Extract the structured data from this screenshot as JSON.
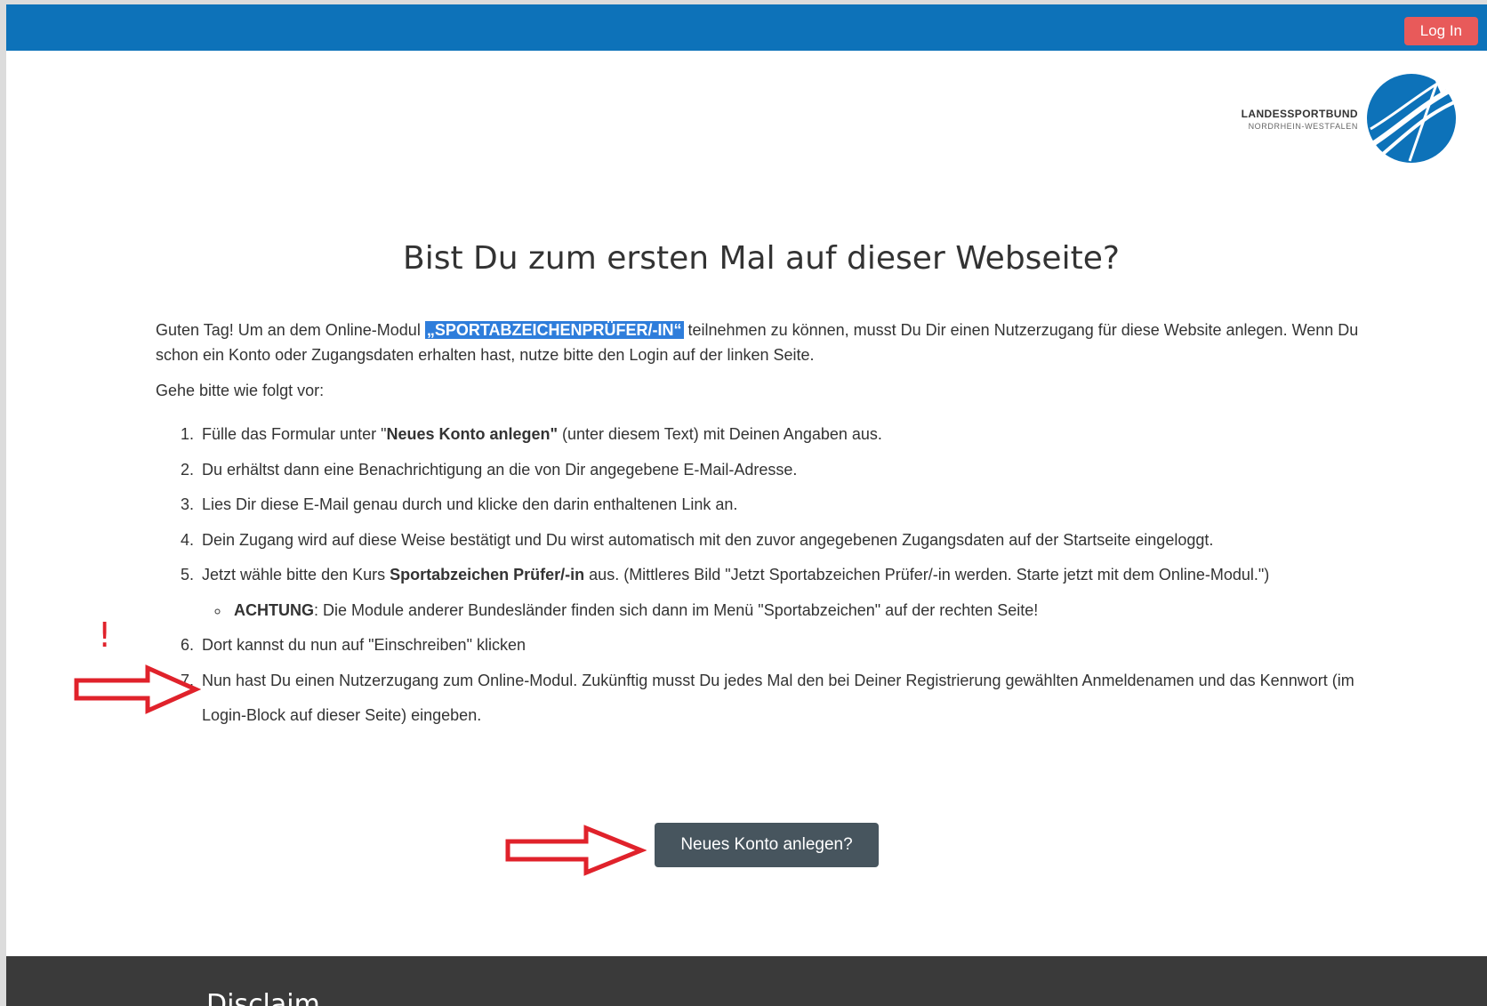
{
  "header": {
    "login_label": "Log In"
  },
  "logo": {
    "line1": "LANDESSPORTBUND",
    "line2": "NORDRHEIN-WESTFALEN"
  },
  "main": {
    "title": "Bist Du zum ersten Mal auf dieser Webseite?",
    "intro_before": "Guten Tag! Um an dem Online-Modul ",
    "intro_highlight": "„SPORTABZEICHENPRÜFER/-IN“",
    "intro_after": " teilnehmen zu können, musst Du Dir einen Nutzerzugang für diese Website anlegen. Wenn Du schon ein Konto oder Zugangsdaten erhalten hast, nutze bitte den Login auf der linken Seite.",
    "lead": "Gehe bitte wie folgt vor:",
    "steps": {
      "s1_a": "Fülle das Formular unter \"",
      "s1_b": "Neues Konto anlegen\"",
      "s1_c": " (unter diesem Text) mit Deinen Angaben aus.",
      "s2": "Du erhältst dann eine Benachrichtigung an die von Dir angegebene E-Mail-Adresse.",
      "s3": "Lies Dir diese E-Mail genau durch und klicke den darin enthaltenen Link an.",
      "s4": "Dein Zugang wird auf diese Weise bestätigt und Du wirst automatisch mit den zuvor angegebenen Zugangsdaten auf der Startseite eingeloggt.",
      "s5_a": "Jetzt wähle bitte den Kurs ",
      "s5_b": "Sportabzeichen Prüfer/-in",
      "s5_c": " aus. (Mittleres Bild \"Jetzt Sportabzeichen Prüfer/-in werden. Starte jetzt mit dem Online-Modul.\")",
      "s5_sub_a": "ACHTUNG",
      "s5_sub_b": ": Die Module anderer Bundesländer finden sich dann im Menü \"Sportabzeichen\" auf der rechten Seite!",
      "s6": "Dort kannst du nun auf \"Einschreiben\" klicken",
      "s7": "Nun hast Du einen Nutzerzugang zum Online-Modul. Zukünftig musst Du jedes Mal den bei Deiner Registrierung gewählten Anmeldenamen und das Kennwort (im Login-Block auf dieser Seite) eingeben."
    },
    "new_account_label": "Neues Konto anlegen?"
  },
  "annotations": {
    "exclamation": "!",
    "color": "#e0222b"
  },
  "footer": {
    "title": "Disclaim"
  },
  "colors": {
    "topbar": "#0d72b9",
    "login_button": "#e85a5a",
    "new_account_button": "#47555e",
    "footer": "#3a3a3a"
  }
}
